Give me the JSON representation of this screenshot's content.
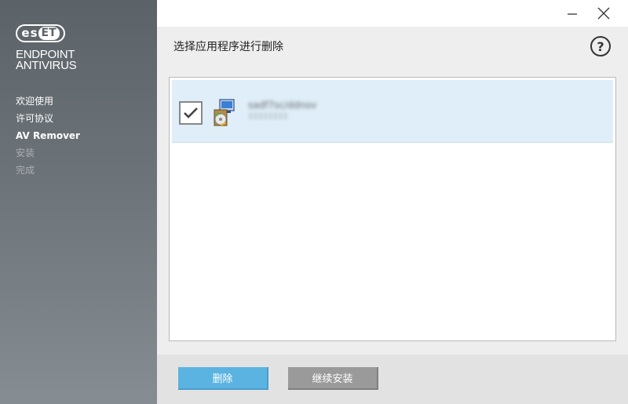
{
  "sidebar": {
    "logo_parts": {
      "e": "e",
      "s": "s",
      "et": "ET"
    },
    "product_line1": "ENDPOINT",
    "product_line2": "ANTIVIRUS",
    "steps": [
      {
        "label": "欢迎使用",
        "state": "done"
      },
      {
        "label": "许可协议",
        "state": "done"
      },
      {
        "label": "AV Remover",
        "state": "current"
      },
      {
        "label": "安装",
        "state": "pending"
      },
      {
        "label": "完成",
        "state": "pending"
      }
    ]
  },
  "window": {
    "minimize_icon": "minimize-icon",
    "close_icon": "close-icon"
  },
  "header": {
    "title": "选择应用程序进行删除",
    "help_label": "?"
  },
  "list": {
    "items": [
      {
        "name": "sadf7sc/ddnov",
        "subtitle": "11111111",
        "checked": true,
        "icon": "installer-package-icon"
      }
    ]
  },
  "footer": {
    "remove_label": "删除",
    "continue_label": "继续安装"
  },
  "colors": {
    "accent": "#5bb3e1",
    "selected_row": "#dfeef8",
    "sidebar_top": "#5b6268",
    "sidebar_bottom": "#868d92"
  }
}
